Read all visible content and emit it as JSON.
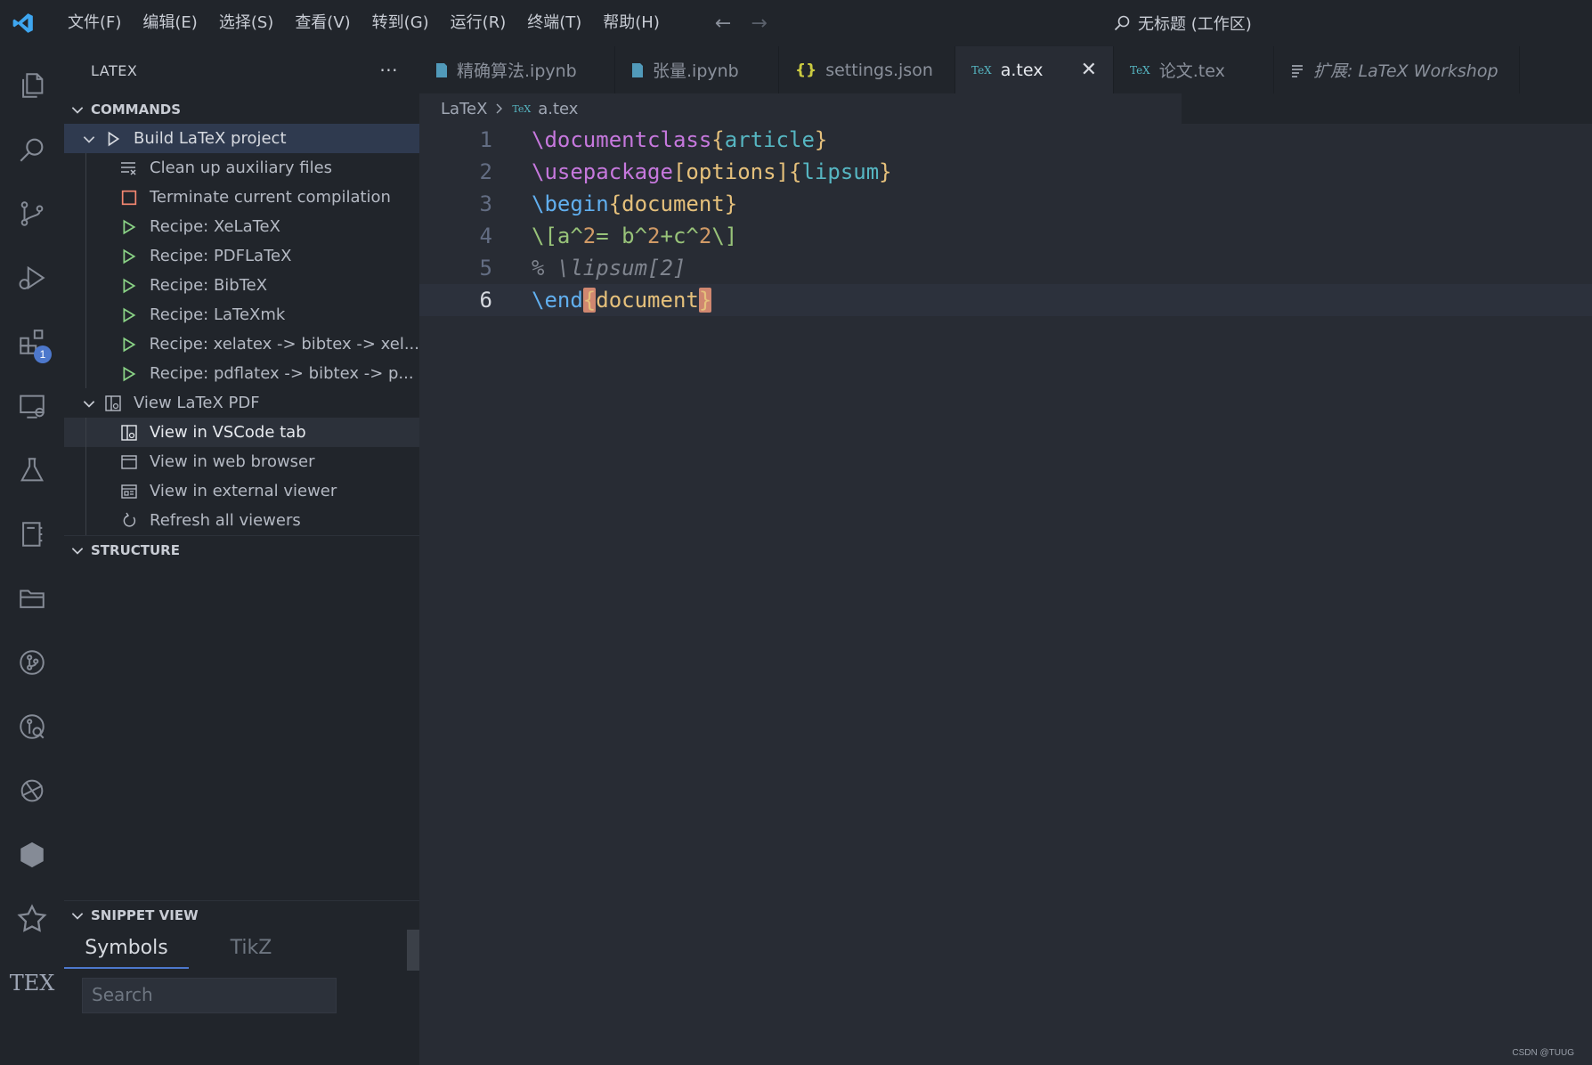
{
  "titlebar": {
    "menu": [
      "文件(F)",
      "编辑(E)",
      "选择(S)",
      "查看(V)",
      "转到(G)",
      "运行(R)",
      "终端(T)",
      "帮助(H)"
    ],
    "search_text": "无标题 (工作区)"
  },
  "activitybar": {
    "icons": [
      "explorer-icon",
      "search-icon",
      "source-control-icon",
      "run-debug-icon",
      "extensions-icon",
      "remote-explorer-icon",
      "testing-icon",
      "notebook-icon",
      "folder-icon",
      "git-graph-icon",
      "gitlens-icon",
      "live-share-icon",
      "hexagon-icon",
      "bug-icon",
      "tex-icon"
    ],
    "extensions_badge": "1",
    "tex_label": "TEX"
  },
  "sidebar": {
    "title": "LATEX",
    "more": "···",
    "commands_title": "COMMANDS",
    "commands": [
      {
        "label": "Build LaTeX project",
        "icon": "play-outline-icon"
      },
      {
        "label": "Clean up auxiliary files",
        "icon": "clear-all-icon"
      },
      {
        "label": "Terminate current compilation",
        "icon": "stop-square-icon"
      },
      {
        "label": "Recipe: XeLaTeX",
        "icon": "play-green-icon"
      },
      {
        "label": "Recipe: PDFLaTeX",
        "icon": "play-green-icon"
      },
      {
        "label": "Recipe: BibTeX",
        "icon": "play-green-icon"
      },
      {
        "label": "Recipe: LaTeXmk",
        "icon": "play-green-icon"
      },
      {
        "label": "Recipe: xelatex -> bibtex -> xel...",
        "icon": "play-green-icon"
      },
      {
        "label": "Recipe: pdflatex -> bibtex -> p...",
        "icon": "play-green-icon"
      }
    ],
    "view_pdf": {
      "label": "View LaTeX PDF",
      "children": [
        {
          "label": "View in VSCode tab",
          "icon": "preview-icon"
        },
        {
          "label": "View in web browser",
          "icon": "browser-icon"
        },
        {
          "label": "View in external viewer",
          "icon": "external-viewer-icon"
        },
        {
          "label": "Refresh all viewers",
          "icon": "refresh-icon"
        }
      ]
    },
    "structure_title": "STRUCTURE",
    "snippet_title": "SNIPPET VIEW",
    "snippet_tabs": [
      "Symbols",
      "TikZ"
    ],
    "snippet_search_placeholder": "Search"
  },
  "tabs": [
    {
      "label": "精确算法.ipynb",
      "icon": "notebook-file-icon",
      "icon_color": "#519aba"
    },
    {
      "label": "张量.ipynb",
      "icon": "notebook-file-icon",
      "icon_color": "#519aba"
    },
    {
      "label": "settings.json",
      "icon": "json-braces-icon",
      "icon_color": "#cbcb41"
    },
    {
      "label": "a.tex",
      "icon": "tex-file-icon",
      "icon_color": "#56b6c2",
      "active": true
    },
    {
      "label": "论文.tex",
      "icon": "tex-file-icon",
      "icon_color": "#56b6c2"
    },
    {
      "label": "扩展: LaTeX Workshop",
      "icon": "extension-preview-icon",
      "italic": true
    }
  ],
  "breadcrumb": {
    "folder": "LaTeX",
    "file": "a.tex",
    "file_icon_label": "TeX"
  },
  "editor": {
    "current_line": 6,
    "lines": [
      {
        "n": "1",
        "raw": "\\documentclass{article}"
      },
      {
        "n": "2",
        "raw": "\\usepackage[options]{lipsum}"
      },
      {
        "n": "3",
        "raw": "\\begin{document}"
      },
      {
        "n": "4",
        "raw": "\\[a^2= b^2+c^2\\]"
      },
      {
        "n": "5",
        "raw": "% \\lipsum[2]"
      },
      {
        "n": "6",
        "raw": "\\end{document}"
      }
    ]
  },
  "watermark": "CSDN @TUUG",
  "colors": {
    "accent": "#4d78cc",
    "editor_bg": "#282c34",
    "sidebar_bg": "#21252b",
    "play_green": "#89d185",
    "stop_red": "#f48771"
  }
}
